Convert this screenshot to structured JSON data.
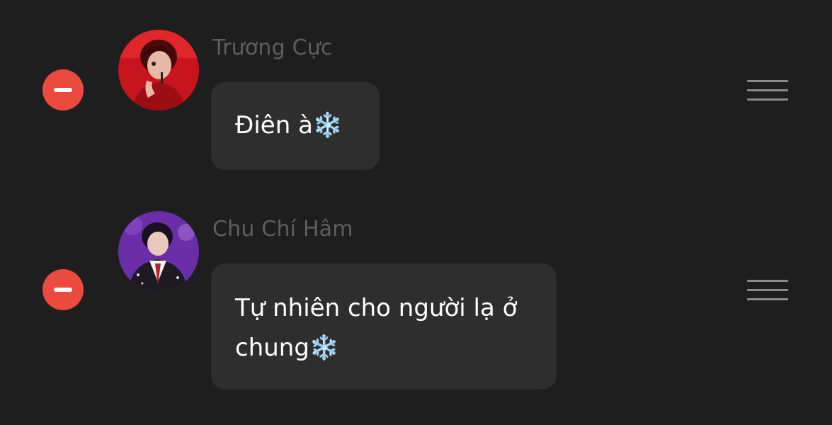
{
  "messages": [
    {
      "sender": "Trương Cực",
      "text": "Điên à",
      "emoji": "❄️",
      "emoji_icon": "snowflake-icon",
      "avatar_colors": {
        "background": "#c8141c",
        "accent": "#8a0c10"
      }
    },
    {
      "sender": "Chu Chí Hâm",
      "text": "Tự nhiên cho người lạ ở chung",
      "emoji": "❄️",
      "emoji_icon": "snowflake-icon",
      "avatar_colors": {
        "background": "#6a2fa8",
        "accent": "#2a1a3a"
      }
    }
  ],
  "controls": {
    "delete_icon": "minus-circle-icon",
    "reorder_icon": "drag-handle-icon"
  },
  "colors": {
    "background": "#1e1e1e",
    "bubble": "#2e2e2e",
    "sender_text": "#5e5e5e",
    "delete_red": "#eb4b3f",
    "handle_gray": "#8a8a8a"
  }
}
